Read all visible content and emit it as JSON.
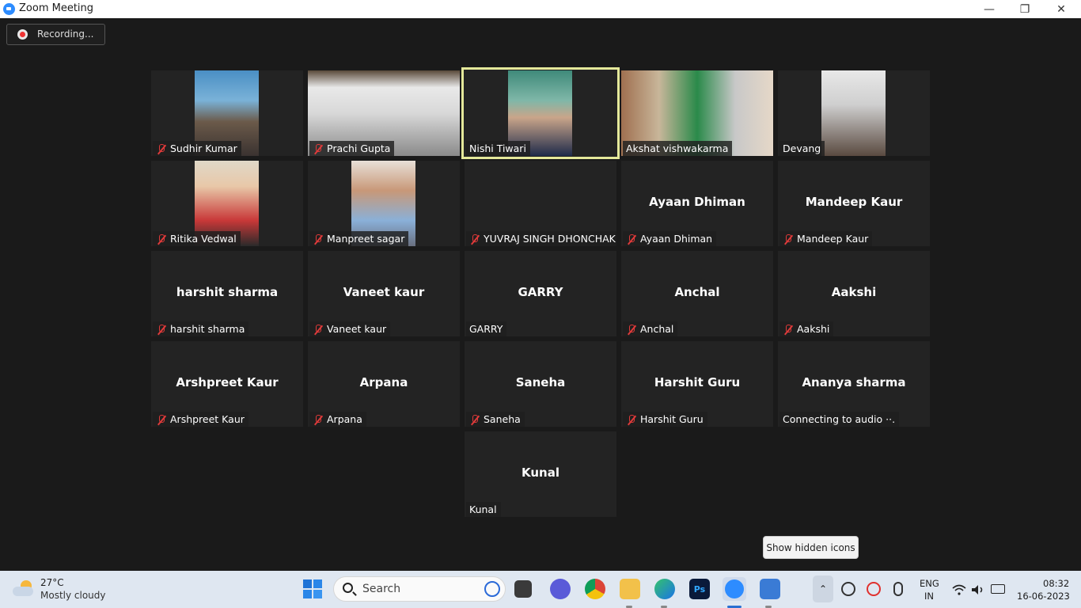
{
  "window": {
    "title": "Zoom Meeting",
    "minimize": "—",
    "restore": "❐",
    "close": "✕"
  },
  "recording": {
    "label": "Recording..."
  },
  "participants": [
    {
      "name": "Sudhir Kumar",
      "muted": true,
      "video": true
    },
    {
      "name": "Prachi Gupta",
      "muted": true,
      "video": true
    },
    {
      "name": "Nishi Tiwari",
      "muted": false,
      "video": true,
      "active_speaker": true
    },
    {
      "name": "Akshat vishwakarma",
      "muted": false,
      "video": true
    },
    {
      "name": "Devang",
      "muted": false,
      "video": true
    },
    {
      "name": "Ritika Vedwal",
      "muted": true,
      "video": true
    },
    {
      "name": "Manpreet sagar",
      "muted": true,
      "video": true
    },
    {
      "name": "YUVRAJ SINGH DHONCHAK",
      "muted": true,
      "video": false
    },
    {
      "name": "Ayaan Dhiman",
      "display": "Ayaan Dhiman",
      "muted": true,
      "video": false
    },
    {
      "name": "Mandeep Kaur",
      "display": "Mandeep Kaur",
      "muted": true,
      "video": false
    },
    {
      "name": "harshit sharma",
      "display": "harshit sharma",
      "muted": true,
      "video": false
    },
    {
      "name": "Vaneet kaur",
      "display": "Vaneet kaur",
      "muted": true,
      "video": false
    },
    {
      "name": "GARRY",
      "display": "GARRY",
      "muted": false,
      "video": false
    },
    {
      "name": "Anchal",
      "display": "Anchal",
      "muted": true,
      "video": false
    },
    {
      "name": "Aakshi",
      "display": "Aakshi",
      "muted": true,
      "video": false
    },
    {
      "name": "Arshpreet Kaur",
      "display": "Arshpreet Kaur",
      "muted": true,
      "video": false
    },
    {
      "name": "Arpana",
      "display": "Arpana",
      "muted": true,
      "video": false
    },
    {
      "name": "Saneha",
      "display": "Saneha",
      "muted": true,
      "video": false
    },
    {
      "name": "Harshit Guru",
      "display": "Harshit Guru",
      "muted": true,
      "video": false
    },
    {
      "name": "Connecting to audio ··.",
      "display": "Ananya sharma",
      "muted": false,
      "video": false
    },
    {
      "name": "Kunal",
      "display": "Kunal",
      "muted": false,
      "video": false
    }
  ],
  "tooltip": {
    "text": "Show hidden icons"
  },
  "taskbar": {
    "weather": {
      "temp": "27°C",
      "condition": "Mostly cloudy"
    },
    "search_placeholder": "Search",
    "lang": "ENG",
    "region": "IN",
    "time": "08:32",
    "date": "16-06-2023"
  }
}
